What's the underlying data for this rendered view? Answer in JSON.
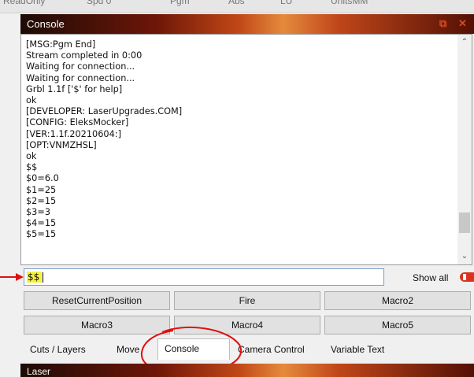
{
  "top_strip": {
    "faint_items": [
      "ReadOnly",
      "Spd 0",
      "Pgm",
      "Abs",
      "LU",
      "UnitsMM"
    ]
  },
  "console_panel": {
    "title": "Console",
    "float_icon": "restore-window-icon",
    "close_icon": "close-icon",
    "output_lines": [
      "[MSG:Pgm End]",
      "Stream completed in 0:00",
      "Waiting for connection...",
      "Waiting for connection...",
      "Grbl 1.1f ['$' for help]",
      "ok",
      "[DEVELOPER: LaserUpgrades.COM]",
      "[CONFIG: EleksMocker]",
      "[VER:1.1f.20210604:]",
      "[OPT:VNMZHSL]",
      "ok",
      "$$",
      "$0=6.0",
      "$1=25",
      "$2=15",
      "$3=3",
      "$4=15",
      "$5=15"
    ],
    "input_value": "$$",
    "show_all_label": "Show all",
    "show_all_on": true
  },
  "buttons": [
    {
      "label": "ResetCurrentPosition"
    },
    {
      "label": "Fire"
    },
    {
      "label": "Macro2"
    },
    {
      "label": "Macro3"
    },
    {
      "label": "Macro4"
    },
    {
      "label": "Macro5"
    }
  ],
  "tabs": [
    {
      "label": "Cuts / Layers",
      "active": false
    },
    {
      "label": "Move",
      "active": false
    },
    {
      "label": "Console",
      "active": true
    },
    {
      "label": "Camera Control",
      "active": false
    },
    {
      "label": "Variable Text",
      "active": false
    }
  ],
  "laser_panel": {
    "title": "Laser"
  },
  "colors": {
    "highlight": "#f6f23a",
    "annotation_red": "#e01010",
    "toggle_on": "#d9331f"
  }
}
